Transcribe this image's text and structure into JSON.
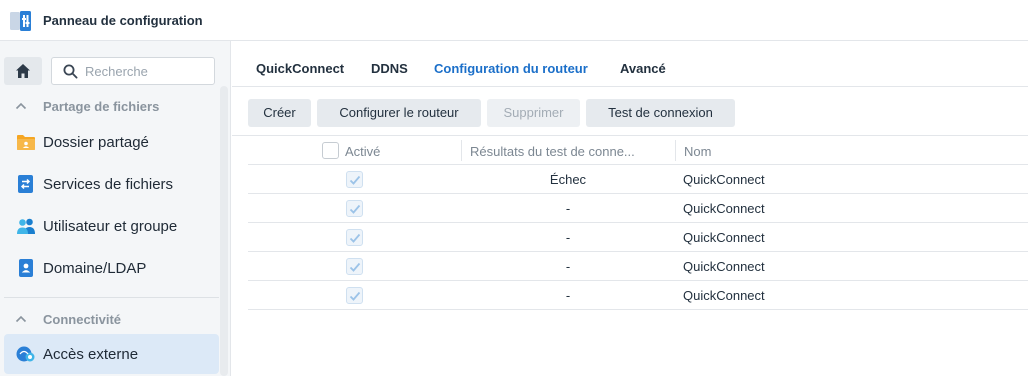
{
  "window": {
    "title": "Panneau de configuration"
  },
  "sidebar": {
    "search_placeholder": "Recherche",
    "sections": [
      {
        "label": "Partage de fichiers",
        "items": [
          {
            "label": "Dossier partagé",
            "icon": "folder-icon"
          },
          {
            "label": "Services de fichiers",
            "icon": "file-services-icon"
          },
          {
            "label": "Utilisateur et groupe",
            "icon": "users-icon"
          },
          {
            "label": "Domaine/LDAP",
            "icon": "domain-icon"
          }
        ]
      },
      {
        "label": "Connectivité",
        "items": [
          {
            "label": "Accès externe",
            "icon": "external-access-icon",
            "selected": true
          }
        ]
      }
    ]
  },
  "tabs": [
    {
      "label": "QuickConnect"
    },
    {
      "label": "DDNS"
    },
    {
      "label": "Configuration du routeur",
      "active": true
    },
    {
      "label": "Avancé"
    }
  ],
  "toolbar": {
    "create": "Créer",
    "configure": "Configurer le routeur",
    "delete": "Supprimer",
    "test": "Test de connexion"
  },
  "table": {
    "columns": [
      "Activé",
      "Résultats du test de conne...",
      "Nom"
    ],
    "rows": [
      {
        "enabled": true,
        "result": "Échec",
        "name": "QuickConnect"
      },
      {
        "enabled": true,
        "result": "-",
        "name": "QuickConnect"
      },
      {
        "enabled": true,
        "result": "-",
        "name": "QuickConnect"
      },
      {
        "enabled": true,
        "result": "-",
        "name": "QuickConnect"
      },
      {
        "enabled": true,
        "result": "-",
        "name": "QuickConnect"
      }
    ]
  },
  "colors": {
    "accent": "#1b6fc9",
    "selected_bg": "#dce9f7"
  }
}
